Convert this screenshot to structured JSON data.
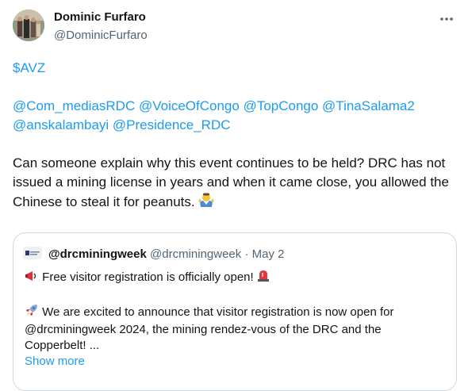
{
  "author": {
    "name": "Dominic Furfaro",
    "handle": "@DominicFurfaro"
  },
  "tweet": {
    "cashtag": "$AVZ",
    "mentions_line1": "@Com_mediasRDC @VoiceOfCongo @TopCongo @TinaSalama2",
    "mentions_line2": "@anskalambayi @Presidence_RDC",
    "text": "Can someone explain why this event continues to be held? DRC has not issued a mining license in years and when it came close, you allowed the Chinese to steal it for peanuts.",
    "emoji_icon": "person-shrugging-icon"
  },
  "quoted_tweet": {
    "name": "@drcminingweek",
    "handle": "@drcminingweek",
    "separator": "·",
    "date": "May 2",
    "line1": "Free visitor registration is officially open!",
    "line2": "We are excited to announce that visitor registration is now open for @drcminingweek 2024, the mining rendez-vous of the DRC and the Copperbelt! ...",
    "show_more": "Show more",
    "icons": [
      "megaphone-icon",
      "siren-icon",
      "rocket-icon"
    ]
  },
  "colors": {
    "link": "#1d9bf0",
    "text": "#0f1419",
    "secondary": "#536471",
    "border": "#cfd9de"
  }
}
